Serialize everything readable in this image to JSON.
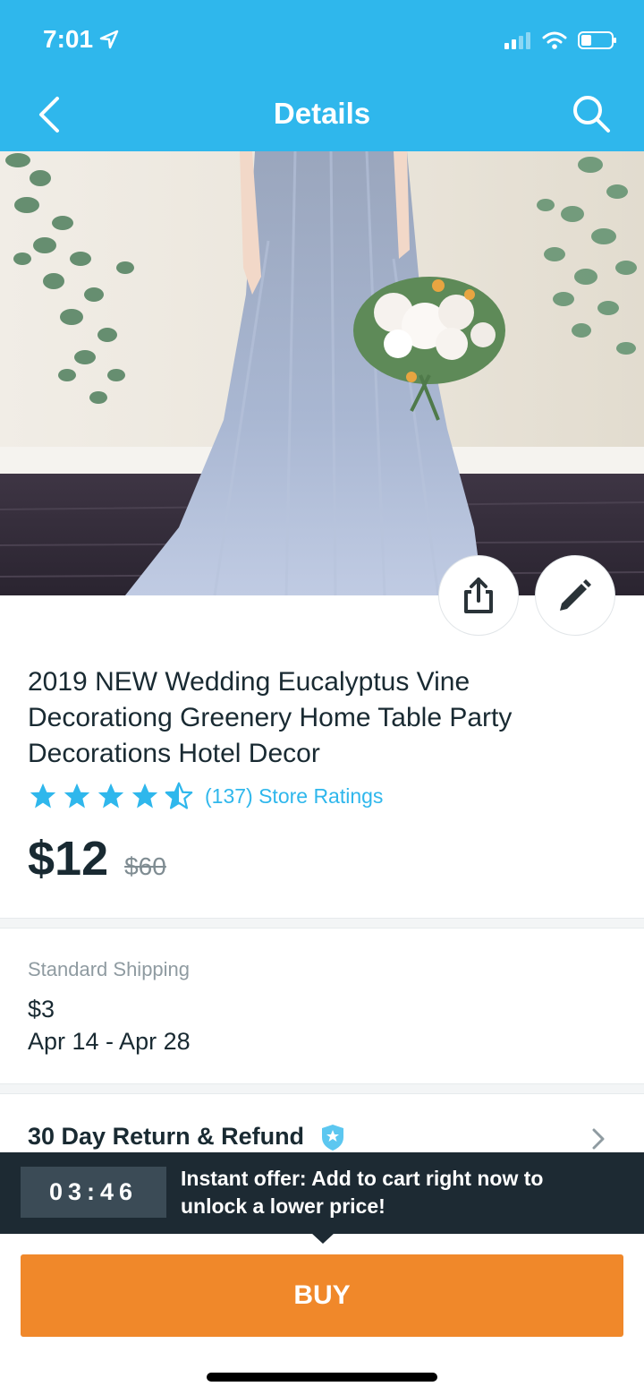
{
  "status": {
    "time": "7:01",
    "location_icon": "location-arrow-icon",
    "signal_icon": "signal-icon",
    "wifi_icon": "wifi-icon",
    "battery_icon": "battery-icon"
  },
  "nav": {
    "title": "Details",
    "back_icon": "chevron-left-icon",
    "search_icon": "search-icon"
  },
  "product": {
    "image_description_icon": "product-image",
    "title": "2019 NEW Wedding Eucalyptus Vine Decorationg Greenery Home Table Party Decorations Hotel Decor",
    "rating": 4.5,
    "ratings_text": "(137) Store Ratings",
    "price": "$12",
    "original_price": "$60"
  },
  "actions": {
    "share_icon": "share-icon",
    "edit_icon": "pencil-icon"
  },
  "shipping": {
    "label": "Standard Shipping",
    "price": "$3",
    "dates": "Apr 14 - Apr 28"
  },
  "returns": {
    "text": "30 Day Return & Refund",
    "shield_icon": "shield-icon",
    "chevron_icon": "chevron-right-icon"
  },
  "offer": {
    "timer": "03:46",
    "text": "Instant offer: Add to cart right now to unlock a lower price!"
  },
  "buy": {
    "label": "BUY"
  },
  "colors": {
    "header": "#2fb7ec",
    "star": "#2fb7ec",
    "buy_button": "#f0882a",
    "banner": "#1d2a33",
    "text": "#192a32"
  }
}
